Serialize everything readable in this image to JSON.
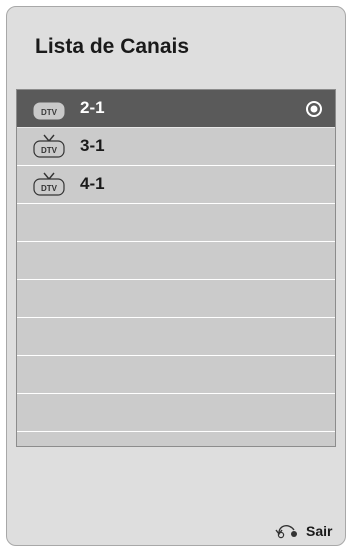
{
  "screen": {
    "title": "Lista de Canais",
    "exit_label": "Sair"
  },
  "channels": [
    {
      "label": "2-1",
      "badge": "DTV",
      "selected": true
    },
    {
      "label": "3-1",
      "badge": "DTV",
      "selected": false
    },
    {
      "label": "4-1",
      "badge": "DTV",
      "selected": false
    }
  ],
  "icons": {
    "channel_type": "tv-icon",
    "selection": "radio-selected-icon",
    "exit": "return-arrow-icon"
  },
  "colors": {
    "panel_bg": "#dedede",
    "list_bg": "#cbcbcb",
    "selected_row": "#5a5a5a"
  }
}
